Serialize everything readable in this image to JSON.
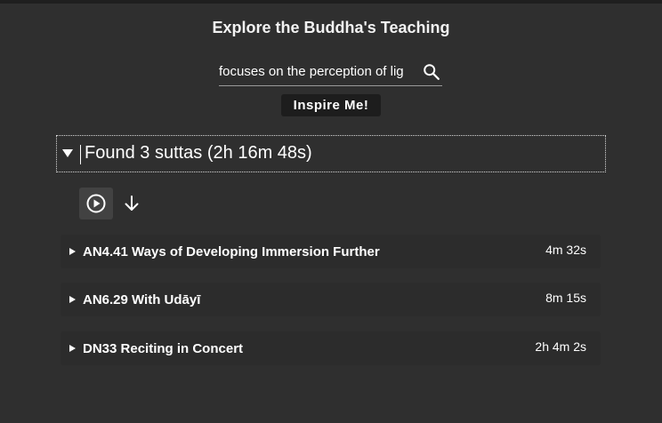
{
  "header": {
    "title": "Explore the Buddha's Teaching"
  },
  "search": {
    "value": "focuses on the perception of lig",
    "icon": "search-icon"
  },
  "inspire": {
    "label": "Inspire Me!"
  },
  "results": {
    "title": "Found 3 suttas (2h 16m 48s)",
    "expanded": true,
    "actions": {
      "play_icon": "play-circle-icon",
      "download_icon": "arrow-down-icon"
    },
    "items": [
      {
        "title": "AN4.41 Ways of Developing Immersion Further",
        "duration": "4m 32s"
      },
      {
        "title": "AN6.29 With Udāyī",
        "duration": "8m 15s"
      },
      {
        "title": "DN33 Reciting in Concert",
        "duration": "2h 4m 2s"
      }
    ]
  },
  "colors": {
    "background": "#2f2f2f",
    "row_background": "#2c2c2c",
    "button_background": "#1d1d1d",
    "text": "#ffffff"
  }
}
